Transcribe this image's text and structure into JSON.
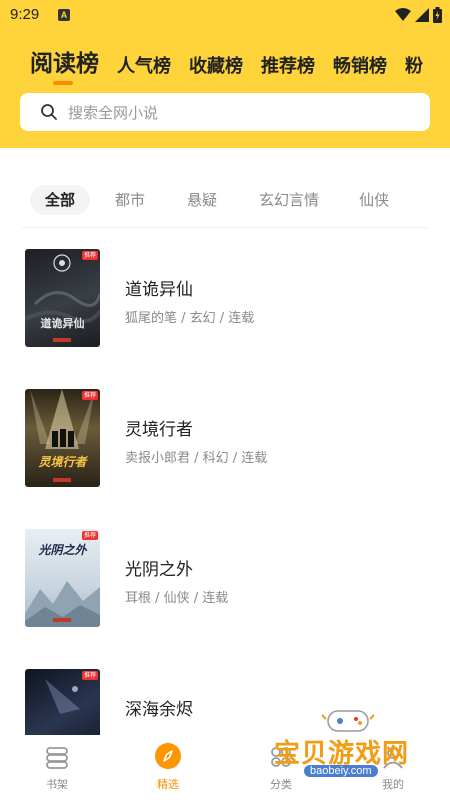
{
  "status": {
    "time": "9:29",
    "notification_badge": "A"
  },
  "rank_tabs": [
    "阅读榜",
    "人气榜",
    "收藏榜",
    "推荐榜",
    "畅销榜",
    "粉"
  ],
  "search": {
    "placeholder": "搜索全网小说"
  },
  "categories": [
    "全部",
    "都市",
    "悬疑",
    "玄幻言情",
    "仙侠"
  ],
  "books": [
    {
      "title": "道诡异仙",
      "meta": "狐尾的笔 / 玄幻 / 连载",
      "cover_text": "道诡异仙",
      "cover_tag": "推荐"
    },
    {
      "title": "灵境行者",
      "meta": "卖报小郎君 / 科幻 / 连载",
      "cover_text": "灵境行者",
      "cover_tag": "推荐"
    },
    {
      "title": "光阴之外",
      "meta": "耳根 / 仙侠 / 连载",
      "cover_text": "光阴之外",
      "cover_tag": "推荐"
    },
    {
      "title": "深海余烬",
      "meta": "",
      "cover_text": "",
      "cover_tag": "推荐"
    }
  ],
  "nav": [
    {
      "label": "书架",
      "icon": "bookshelf-icon"
    },
    {
      "label": "精选",
      "icon": "compass-icon"
    },
    {
      "label": "分类",
      "icon": "category-icon"
    },
    {
      "label": "我的",
      "icon": "profile-icon"
    }
  ],
  "watermark": {
    "text": "宝贝游戏网",
    "url": "baobeiy.com"
  },
  "colors": {
    "accent_yellow": "#FFD43B",
    "accent_orange": "#FF8C00"
  }
}
